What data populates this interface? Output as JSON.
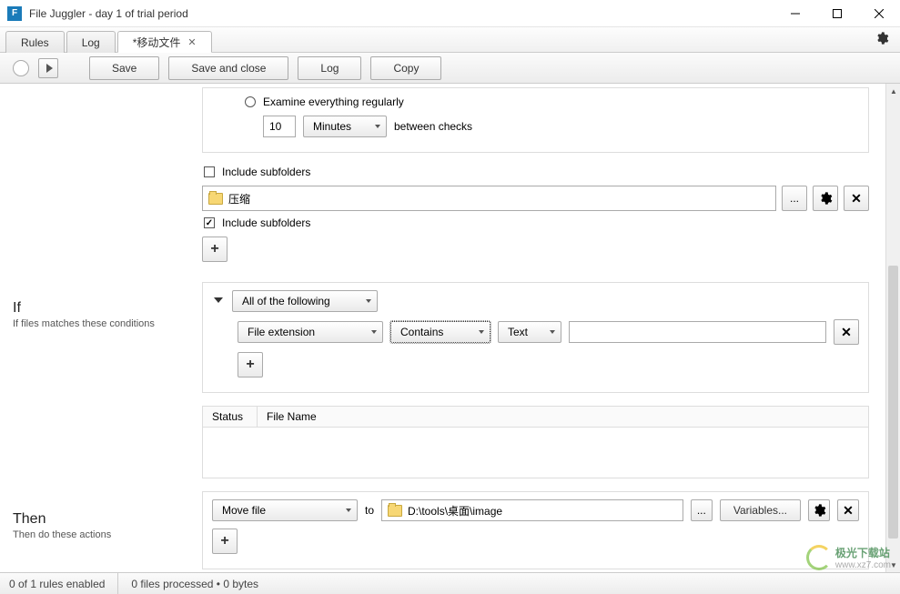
{
  "window": {
    "title": "File Juggler - day 1 of trial period",
    "icon_letter": "F"
  },
  "tabs": [
    {
      "label": "Rules",
      "active": false,
      "closable": false
    },
    {
      "label": "Log",
      "active": false,
      "closable": false
    },
    {
      "label": "*移动文件",
      "active": true,
      "closable": true
    }
  ],
  "toolbar": {
    "save": "Save",
    "save_close": "Save and close",
    "log": "Log",
    "copy": "Copy"
  },
  "monitor": {
    "examine_label": "Examine everything regularly",
    "interval_value": "10",
    "interval_unit": "Minutes",
    "between_label": "between checks",
    "include_subfolders_top": "Include subfolders",
    "folder1": "压缩",
    "include_subfolders_folder1": "Include subfolders"
  },
  "if_section": {
    "title": "If",
    "subtitle": "If files matches these conditions",
    "combiner": "All of the following",
    "cond_field": "File extension",
    "cond_op": "Contains",
    "cond_type": "Text",
    "table_status": "Status",
    "table_filename": "File Name"
  },
  "then_section": {
    "title": "Then",
    "subtitle": "Then do these actions",
    "action": "Move file",
    "to_label": "to",
    "dest_path": "D:\\tools\\桌面\\image",
    "variables": "Variables..."
  },
  "status": {
    "rules": "0 of 1 rules enabled",
    "processed": "0 files processed • 0 bytes"
  },
  "watermark": {
    "text": "极光下载站",
    "url": "www.xz7.com"
  }
}
